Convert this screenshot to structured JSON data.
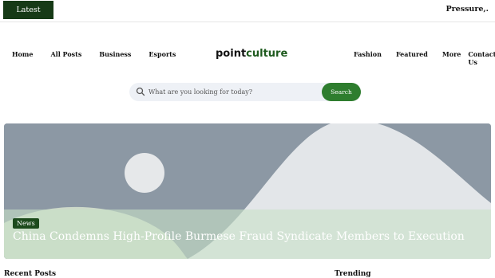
{
  "topbar": {
    "latest_label": "Latest Update",
    "ticker_text": "Pressure,."
  },
  "nav": {
    "left": [
      "Home",
      "All Posts",
      "Business",
      "Esports"
    ],
    "right": [
      "Fashion",
      "Featured",
      "More",
      "Contact Us"
    ]
  },
  "logo": {
    "part1": "point",
    "part2": "culture"
  },
  "search": {
    "placeholder": "What are you looking for today?",
    "button_label": "Search"
  },
  "hero": {
    "badge": "News",
    "title": "China Condemns High-Profile Burmese Fraud Syndicate Members to Execution"
  },
  "sections": {
    "recent_posts": "Recent Posts",
    "trending": "Trending"
  },
  "colors": {
    "brand_green": "#2e7d2e",
    "dark_green": "#163a16"
  }
}
